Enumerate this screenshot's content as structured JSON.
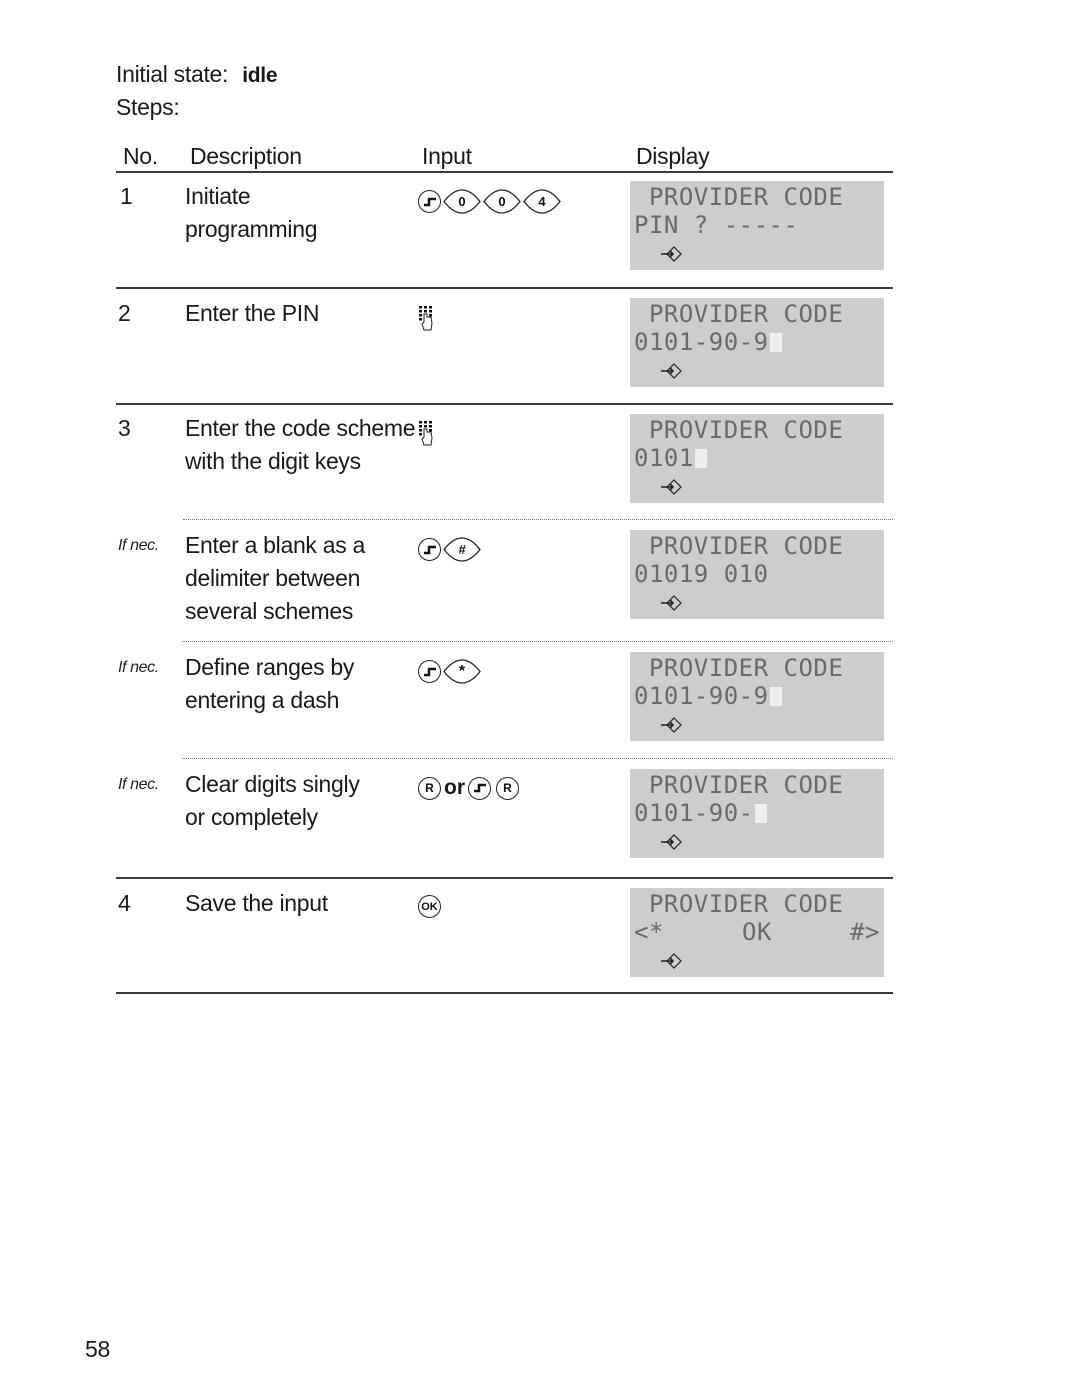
{
  "header": {
    "initial_state_label": "Initial state:",
    "initial_state_value": "idle",
    "steps_label": "Steps:"
  },
  "table": {
    "columns": [
      "No.",
      "Description",
      "Input",
      "Display"
    ],
    "rows": [
      {
        "no": "1",
        "qualifier": "",
        "description": [
          "Initiate",
          "programming"
        ],
        "input": {
          "keys": [
            "line-key-icon",
            "0",
            "0",
            "4"
          ]
        },
        "display": {
          "line1": " PROVIDER CODE",
          "line2": "PIN ? -----",
          "cursor": false
        }
      },
      {
        "no": "2",
        "qualifier": "",
        "description": [
          "Enter the PIN"
        ],
        "input": {
          "keys": [
            "keypad-hand-icon"
          ]
        },
        "display": {
          "line1": " PROVIDER CODE",
          "line2": "0101-90-9",
          "cursor": true
        }
      },
      {
        "no": "3",
        "qualifier": "",
        "description": [
          "Enter the code scheme",
          "with the digit keys"
        ],
        "input": {
          "keys": [
            "keypad-hand-icon"
          ]
        },
        "display": {
          "line1": " PROVIDER CODE",
          "line2": "0101",
          "cursor": true
        }
      },
      {
        "no": "",
        "qualifier": "If nec.",
        "description": [
          "Enter a blank as a",
          "delimiter between",
          "several schemes"
        ],
        "input": {
          "keys": [
            "line-key-icon",
            "#"
          ]
        },
        "display": {
          "line1": " PROVIDER CODE",
          "line2": "01019 010",
          "cursor": false
        }
      },
      {
        "no": "",
        "qualifier": "If nec.",
        "description": [
          "Define ranges by",
          "entering a dash"
        ],
        "input": {
          "keys": [
            "line-key-icon",
            "*"
          ]
        },
        "display": {
          "line1": " PROVIDER CODE",
          "line2": "0101-90-9",
          "cursor": true
        }
      },
      {
        "no": "",
        "qualifier": "If nec.",
        "description": [
          "Clear digits singly",
          "or completely"
        ],
        "input": {
          "keys": [
            "R",
            "or",
            "line-key-icon",
            "R"
          ]
        },
        "display": {
          "line1": " PROVIDER CODE",
          "line2": "0101-90-",
          "cursor": true
        }
      },
      {
        "no": "4",
        "qualifier": "",
        "description": [
          "Save the input"
        ],
        "input": {
          "keys": [
            "OK"
          ]
        },
        "display": {
          "line1": " PROVIDER CODE",
          "line2_parts": [
            "<*",
            "OK",
            "#>"
          ],
          "cursor": false
        }
      }
    ],
    "display_arrow_icon": "enter-arrow-icon"
  },
  "footer": {
    "page_number": "58"
  }
}
